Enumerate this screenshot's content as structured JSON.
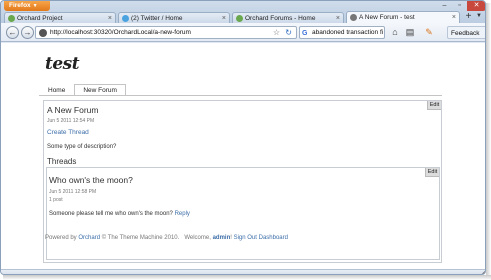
{
  "browser": {
    "menu_button": "Firefox",
    "tabs": [
      {
        "label": "Orchard Project",
        "active": false
      },
      {
        "label": "(2) Twitter / Home",
        "active": false
      },
      {
        "label": "Orchard Forums - Home",
        "active": false
      },
      {
        "label": "A New Forum - test",
        "active": true
      }
    ],
    "url": "http://localhost:30320/OrchardLocal/a-new-forum",
    "search_value": "abandoned transaction fi",
    "feedback_label": "Feedback"
  },
  "site": {
    "title": "test",
    "menu": [
      {
        "label": "Home",
        "selected": false
      },
      {
        "label": "New Forum",
        "selected": true
      }
    ]
  },
  "forum": {
    "edit_label": "Edit",
    "title": "A New Forum",
    "date": "Jun 5 2011 12:54 PM",
    "create_thread": "Create Thread",
    "description": "Some type of description?",
    "threads_heading": "Threads"
  },
  "thread": {
    "edit_label": "Edit",
    "title": "Who own's the moon?",
    "date": "Jun 5 2011 12:58 PM",
    "post_count": "1 post",
    "body": "Someone please tell me who own's the moon?",
    "reply": "Reply"
  },
  "footer": {
    "powered_by": "Powered by",
    "orchard": "Orchard",
    "theme_text": "© The Theme Machine 2010.",
    "welcome": "Welcome,",
    "user": "admin",
    "sign_out": "Sign Out",
    "dashboard": "Dashboard"
  },
  "colors": {
    "link": "#3c6ea8",
    "firefox_button": "#e88a2a"
  }
}
